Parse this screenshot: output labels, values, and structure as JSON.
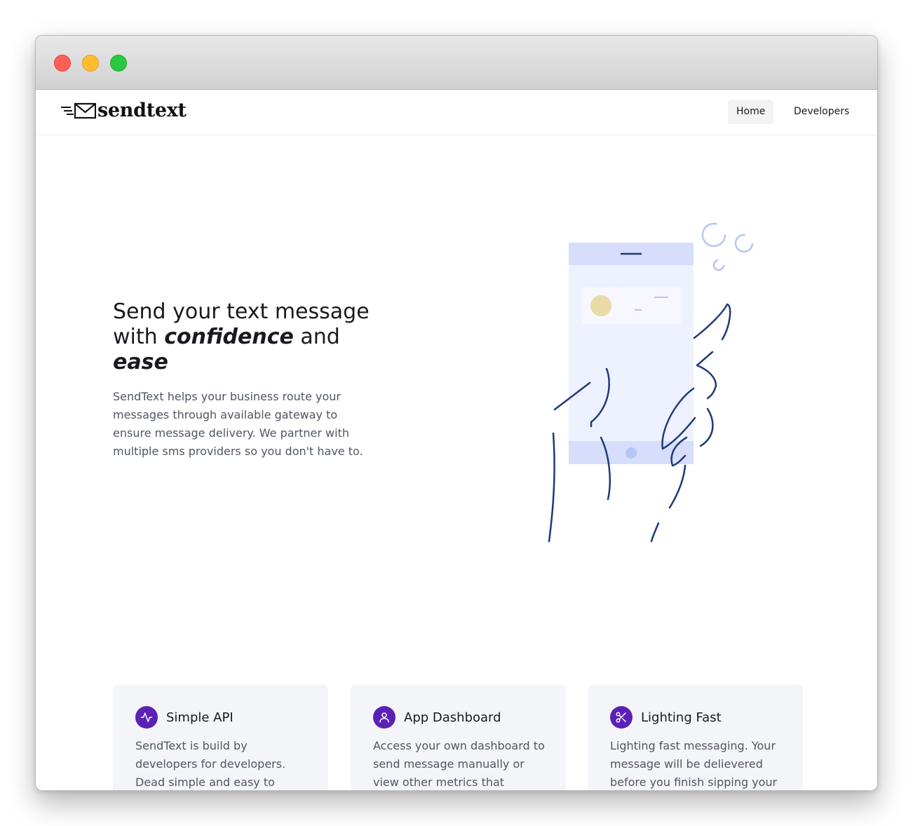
{
  "app": {
    "logo_text": "sendtext"
  },
  "nav": {
    "items": [
      {
        "label": "Home",
        "active": true
      },
      {
        "label": "Developers",
        "active": false
      }
    ]
  },
  "hero": {
    "title_lead": "Send your text message with ",
    "title_emphasis_1": "confidence",
    "title_mid": " and ",
    "title_emphasis_2": "ease",
    "description": "SendText helps your business route your messages through available gateway to ensure message delivery. We partner with multiple sms providers so you don't have to."
  },
  "features": [
    {
      "icon": "activity-icon",
      "title": "Simple API",
      "description": "SendText is build by developers for developers. Dead simple and easy to"
    },
    {
      "icon": "user-icon",
      "title": "App Dashboard",
      "description": "Access your own dashboard to send message manually or view other metrics that"
    },
    {
      "icon": "scissors-icon",
      "title": "Lighting Fast",
      "description": "Lighting fast messaging. Your message will be delievered before you finish sipping your"
    }
  ],
  "colors": {
    "accent": "#5b21b6",
    "text_dark": "#181a20",
    "text_muted": "#4f5661",
    "card_bg": "#f4f5f8",
    "illustration_stroke": "#1e3a78",
    "phone_body": "#eef1ff",
    "phone_band": "#d6defb"
  }
}
